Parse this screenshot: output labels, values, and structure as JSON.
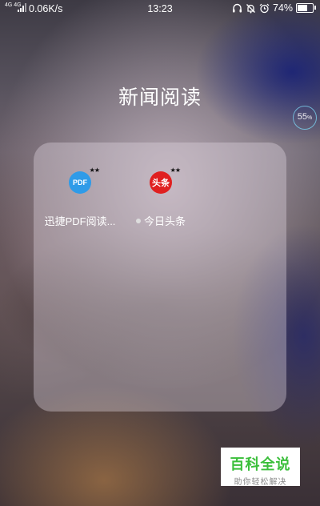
{
  "status_bar": {
    "network": "4G 4G",
    "speed": "0.06K/s",
    "time": "13:23",
    "battery_percent": "74%",
    "battery_level": 0.74,
    "icons": [
      "headset-icon",
      "bell-off-icon",
      "alarm-icon",
      "battery-icon"
    ]
  },
  "folder": {
    "title": "新闻阅读",
    "apps": [
      {
        "label": "迅捷PDF阅读...",
        "icon": "pdf-reader-icon",
        "icon_text": "PDF",
        "color": "#2f9be8",
        "new_dot": false
      },
      {
        "label": "今日头条",
        "icon": "toutiao-icon",
        "icon_text": "头条",
        "color": "#e02020",
        "new_dot": true
      }
    ]
  },
  "floating_badge": {
    "value": "55",
    "unit": "%"
  },
  "watermark": {
    "main": "百科全说",
    "sub": "助你轻松解决"
  }
}
